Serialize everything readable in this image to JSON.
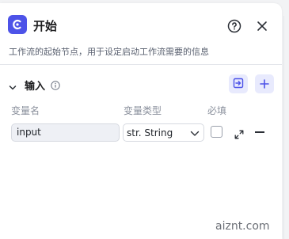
{
  "header": {
    "title": "开始",
    "description": "工作流的起始节点，用于设定启动工作流需要的信息"
  },
  "input_section": {
    "title": "输入",
    "columns": {
      "name": "变量名",
      "type": "变量类型",
      "required": "必填"
    },
    "rows": [
      {
        "name": "input",
        "type": "str. String",
        "required": false
      }
    ]
  },
  "watermark": "aiznt.com",
  "icons": [
    "start-node-icon",
    "help-icon",
    "close-icon",
    "chevron-down-icon",
    "info-icon",
    "import-icon",
    "plus-icon",
    "chevron-down-icon",
    "expand-icon",
    "minus-icon"
  ],
  "colors": {
    "accent": "#4d53e8",
    "button_bg": "#e8eafd"
  }
}
